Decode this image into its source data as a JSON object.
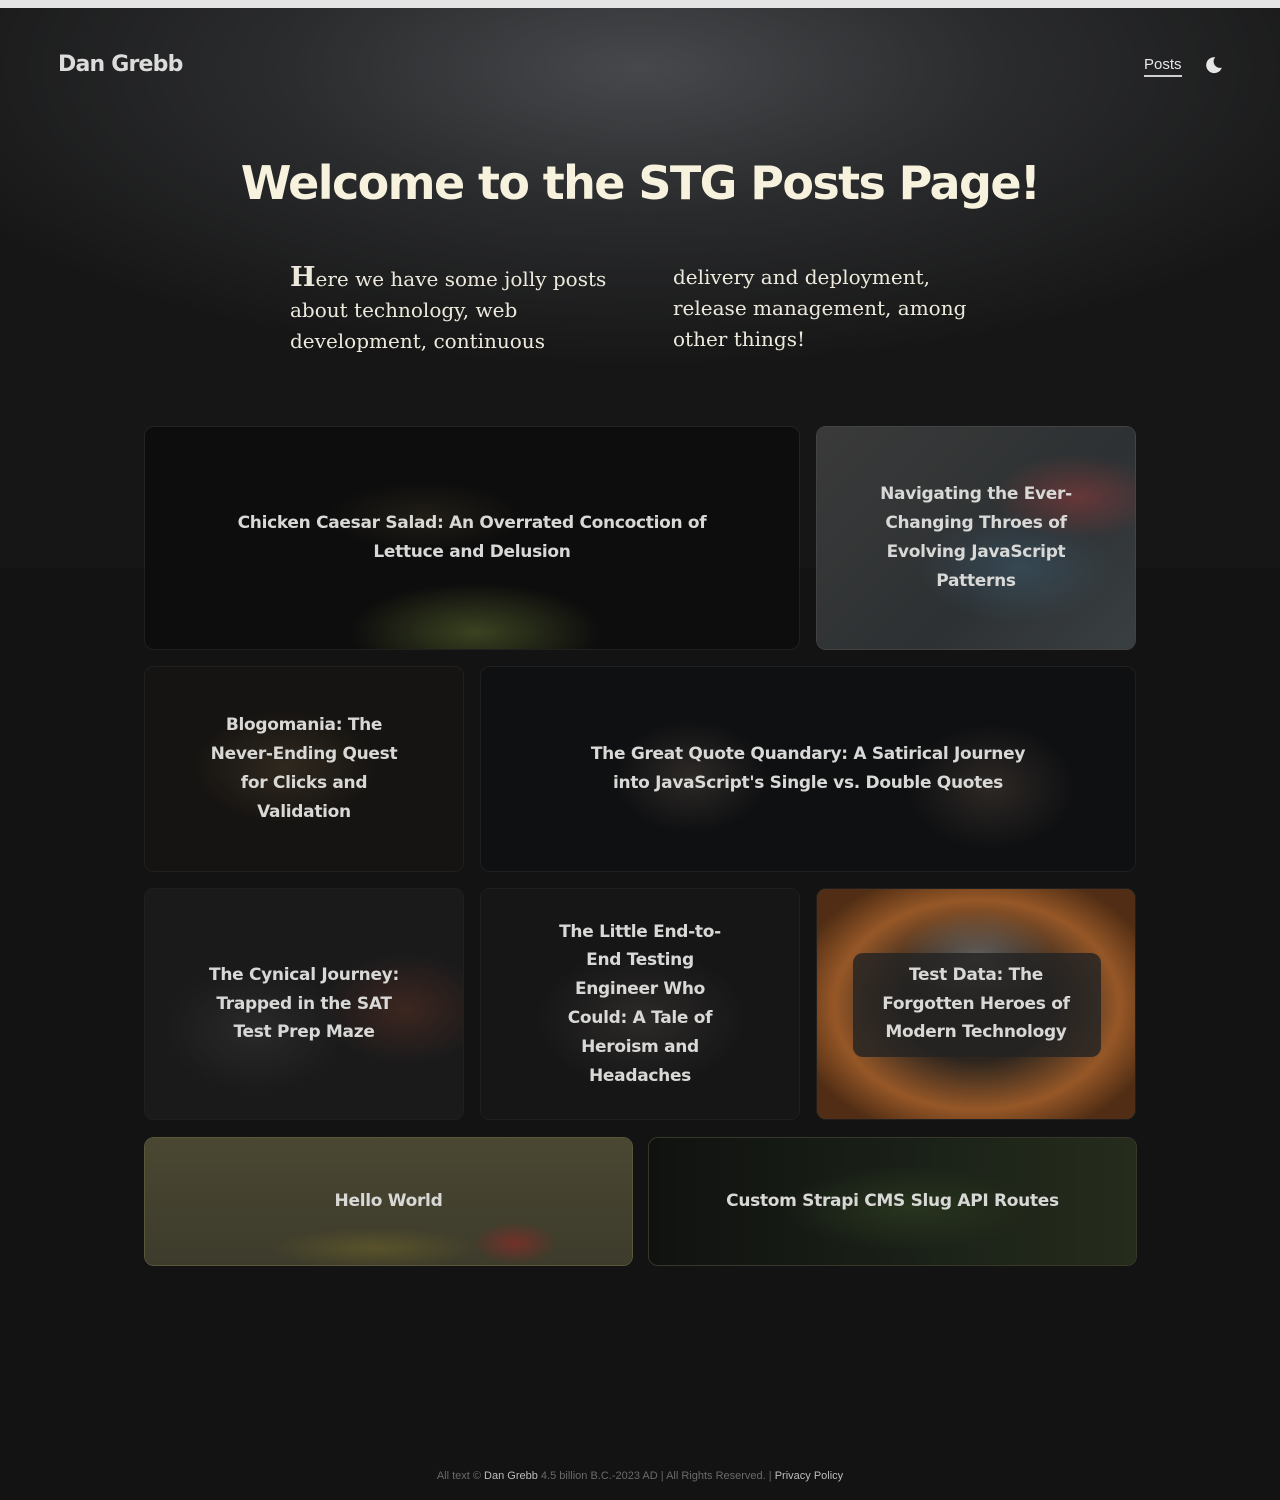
{
  "header": {
    "brand": "Dan Grebb",
    "nav": {
      "posts": "Posts"
    },
    "theme_icon": "moon-icon"
  },
  "hero": {
    "title": "Welcome to the STG Posts Page!",
    "intro": "Here we have some jolly posts about technology, web development, continuous delivery and deployment, release management, among other things!"
  },
  "posts": [
    {
      "title": "Chicken Caesar Salad: An Overrated Concoction of Lettuce and Delusion"
    },
    {
      "title": "Navigating the Ever-Changing Throes of Evolving JavaScript Patterns"
    },
    {
      "title": "Blogomania: The Never-Ending Quest for Clicks and Validation"
    },
    {
      "title": "The Great Quote Quandary: A Satirical Journey into JavaScript's Single vs. Double Quotes"
    },
    {
      "title": "The Cynical Journey: Trapped in the SAT Test Prep Maze"
    },
    {
      "title": "The Little End-to-End Testing Engineer Who Could: A Tale of Heroism and Headaches"
    },
    {
      "title": "Test Data: The Forgotten Heroes of Modern Technology"
    },
    {
      "title": "Hello World"
    },
    {
      "title": "Custom Strapi CMS Slug API Routes"
    }
  ],
  "footer": {
    "prefix": "All text ©",
    "author": "Dan Grebb",
    "range": "4.5 billion B.C.-2023 AD | All Rights Reserved. |",
    "privacy": "Privacy Policy"
  }
}
